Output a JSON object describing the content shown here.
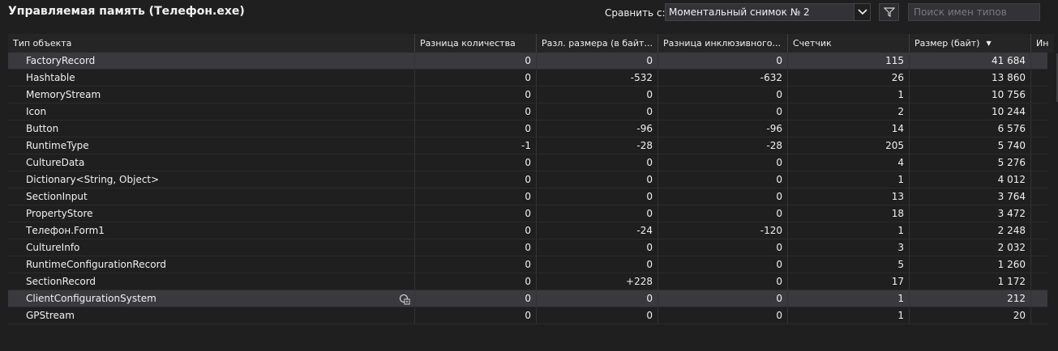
{
  "header": {
    "title": "Управляемая память (Телефон.exe)",
    "compare_label": "Сравнить с:",
    "compare_selected": "Моментальный снимок № 2",
    "search_placeholder": "Поиск имен типов"
  },
  "columns": [
    "Тип объекта",
    "Разница количества",
    "Разл. размера (в байт...",
    "Разница инклюзивного...",
    "Счетчик",
    "Размер (байт)",
    "Ин"
  ],
  "sorted_column": "Размер (байт)",
  "sort_direction": "descending",
  "rows": [
    {
      "name": "FactoryRecord",
      "count_diff": "0",
      "size_diff": "0",
      "incl_diff": "0",
      "count": "115",
      "size": "41 684"
    },
    {
      "name": "Hashtable",
      "count_diff": "0",
      "size_diff": "-532",
      "incl_diff": "-632",
      "count": "26",
      "size": "13 860"
    },
    {
      "name": "MemoryStream",
      "count_diff": "0",
      "size_diff": "0",
      "incl_diff": "0",
      "count": "1",
      "size": "10 756"
    },
    {
      "name": "Icon",
      "count_diff": "0",
      "size_diff": "0",
      "incl_diff": "0",
      "count": "2",
      "size": "10 244"
    },
    {
      "name": "Button",
      "count_diff": "0",
      "size_diff": "-96",
      "incl_diff": "-96",
      "count": "14",
      "size": "6 576"
    },
    {
      "name": "RuntimeType",
      "count_diff": "-1",
      "size_diff": "-28",
      "incl_diff": "-28",
      "count": "205",
      "size": "5 740"
    },
    {
      "name": "CultureData",
      "count_diff": "0",
      "size_diff": "0",
      "incl_diff": "0",
      "count": "4",
      "size": "5 276"
    },
    {
      "name": "Dictionary<String, Object>",
      "count_diff": "0",
      "size_diff": "0",
      "incl_diff": "0",
      "count": "1",
      "size": "4 012"
    },
    {
      "name": "SectionInput",
      "count_diff": "0",
      "size_diff": "0",
      "incl_diff": "0",
      "count": "13",
      "size": "3 764"
    },
    {
      "name": "PropertyStore",
      "count_diff": "0",
      "size_diff": "0",
      "incl_diff": "0",
      "count": "18",
      "size": "3 472"
    },
    {
      "name": "Телефон.Form1",
      "count_diff": "0",
      "size_diff": "-24",
      "incl_diff": "-120",
      "count": "1",
      "size": "2 248"
    },
    {
      "name": "CultureInfo",
      "count_diff": "0",
      "size_diff": "0",
      "incl_diff": "0",
      "count": "3",
      "size": "2 032"
    },
    {
      "name": "RuntimeConfigurationRecord",
      "count_diff": "0",
      "size_diff": "0",
      "incl_diff": "0",
      "count": "5",
      "size": "1 260"
    },
    {
      "name": "SectionRecord",
      "count_diff": "0",
      "size_diff": "+228",
      "incl_diff": "0",
      "count": "17",
      "size": "1 172"
    },
    {
      "name": "ClientConfigurationSystem",
      "count_diff": "0",
      "size_diff": "0",
      "incl_diff": "0",
      "count": "1",
      "size": "212"
    },
    {
      "name": "GPStream",
      "count_diff": "0",
      "size_diff": "0",
      "incl_diff": "0",
      "count": "1",
      "size": "20"
    }
  ],
  "selected_rows": [
    0,
    14
  ],
  "colors": {
    "background": "#1f1f20",
    "header_bg": "#252526",
    "selected_row": "#3a3a3e",
    "text": "#f1f1f1"
  }
}
